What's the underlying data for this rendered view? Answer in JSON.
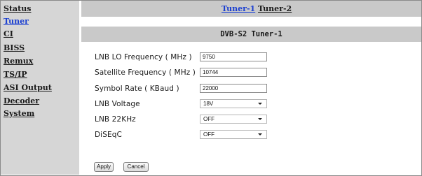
{
  "sidebar": {
    "items": [
      {
        "label": "Status",
        "active": false
      },
      {
        "label": "Tuner",
        "active": true
      },
      {
        "label": "CI",
        "active": false
      },
      {
        "label": "BISS",
        "active": false
      },
      {
        "label": "Remux",
        "active": false
      },
      {
        "label": "TS/IP",
        "active": false
      },
      {
        "label": "ASI Output",
        "active": false
      },
      {
        "label": "Decoder",
        "active": false
      },
      {
        "label": "System",
        "active": false
      }
    ]
  },
  "tabs": [
    {
      "label": "Tuner-1",
      "active": true
    },
    {
      "label": "Tuner-2",
      "active": false
    }
  ],
  "section_title": "DVB-S2 Tuner-1",
  "form": {
    "lnb_lo_frequency": {
      "label": "LNB LO Frequency ( MHz )",
      "value": "9750"
    },
    "satellite_frequency": {
      "label": "Satellite Frequency ( MHz )",
      "value": "10744"
    },
    "symbol_rate": {
      "label": "Symbol Rate ( KBaud )",
      "value": "22000"
    },
    "lnb_voltage": {
      "label": "LNB Voltage",
      "value": "18V"
    },
    "lnb_22khz": {
      "label": "LNB 22KHz",
      "value": "OFF"
    },
    "diseqc": {
      "label": "DiSEqC",
      "value": "OFF"
    }
  },
  "buttons": {
    "apply": "Apply",
    "cancel": "Cancel"
  },
  "colors": {
    "active_link": "#1b3fd1",
    "sidebar_bg": "#d6d6d6",
    "bar_bg": "#c9c9c9"
  }
}
